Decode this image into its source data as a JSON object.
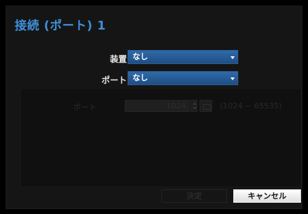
{
  "dialog": {
    "title": "接続 (ポート) 1"
  },
  "device": {
    "label": "装置",
    "value": "なし"
  },
  "port_select": {
    "label": "ポート",
    "value": "なし"
  },
  "port_settings": {
    "label": "ポート",
    "value": "1024",
    "range": "(1024 ~ 65535)"
  },
  "buttons": {
    "ok": "決定",
    "cancel": "キャンセル"
  },
  "icons": {
    "select_caret": "chevron-down-icon",
    "spin_up": "arrow-up-icon",
    "spin_down": "arrow-down-icon",
    "keyboard": "keyboard-icon"
  },
  "colors": {
    "title": "#3f8fd8",
    "select_bg": "#2a5d96"
  }
}
